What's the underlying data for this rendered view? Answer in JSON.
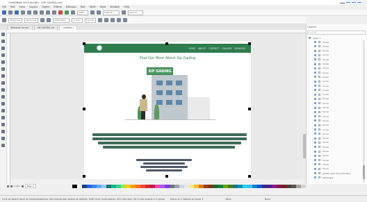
{
  "window": {
    "title": "CorelDRAW 2019 (64-Bit) - [SIP GADING.cdr]"
  },
  "menubar": [
    "File",
    "Edit",
    "View",
    "Layout",
    "Object",
    "Effects",
    "Bitmaps",
    "Text",
    "Table",
    "Tools",
    "Window",
    "Help"
  ],
  "toolbar": {
    "zoom": "100%",
    "snap": "Snap To",
    "launch": "Launch"
  },
  "propertybar": {
    "width": "210.0 mm",
    "height": "297.0 mm",
    "units": "millimeters",
    "nudge": ".1 mm",
    "dup": "5.0 mm"
  },
  "tabs": [
    {
      "label": "Welcome Screen",
      "active": false
    },
    {
      "label": "SIP GADING.cdr",
      "active": false
    },
    {
      "label": "Untitled-1",
      "active": true
    }
  ],
  "document": {
    "banner_links": [
      "HOME",
      "ABOUT",
      "CONTACT",
      "GALLERY",
      "SERVICES"
    ],
    "heading": "Find Out More About Sip Gading",
    "building_sign": "SIP GADING"
  },
  "docker": {
    "title": "Objects",
    "search_placeholder": "Search",
    "layer": "Layer 1",
    "items": [
      "Curve",
      "Curve",
      "Curve",
      "Curve",
      "Curve",
      "Curve",
      "Curve",
      "Curve",
      "Curve",
      "Curve",
      "Curve",
      "Curve",
      "Curve",
      "Curve",
      "Curve",
      "Curve",
      "Curve",
      "Curve",
      "Curve",
      "Curve",
      "Curve",
      "Curve",
      "Curve",
      "Curve",
      "Curve",
      "Curve",
      "Curve",
      "Curve",
      "Curve",
      "Curve",
      "Artistic Text: Find Out More",
      "Rectangle"
    ]
  },
  "pagenav": {
    "page": "Page 1",
    "position": "1 of 1"
  },
  "palette": [
    "#000000",
    "#ffffff",
    "#1e3a8a",
    "#2563eb",
    "#3b82f6",
    "#60a5fa",
    "#93c5fd",
    "#0f766e",
    "#10b981",
    "#34d399",
    "#a3e635",
    "#facc15",
    "#f59e0b",
    "#f97316",
    "#ef4444",
    "#dc2626",
    "#be185d",
    "#ec4899",
    "#a855f7",
    "#7c3aed",
    "#6b7280",
    "#9ca3af",
    "#d1d5db",
    "#e5e7eb",
    "#fde68a",
    "#fbbf24",
    "#d97706",
    "#92400e",
    "#78350f",
    "#166534",
    "#15803d",
    "#65a30d",
    "#4d7c0f",
    "#0e7490",
    "#0891b2",
    "#22d3ee",
    "#38bdf8",
    "#0284c7",
    "#1d4ed8",
    "#312e81",
    "#4c1d95",
    "#86198f",
    "#831843",
    "#7f1d1d",
    "#44403c",
    "#57534e",
    "#a8a29e",
    "#d6d3d1"
  ],
  "status": {
    "hint": "Click an object twice for rotating/skewing; dbl-clicking tool selects all objects; Shift+click multi-selects; Alt+click digs; Ctrl+click selects in a group",
    "info": "Group of 2 Objects on Layer 1",
    "fill": "None",
    "outline": "None"
  }
}
